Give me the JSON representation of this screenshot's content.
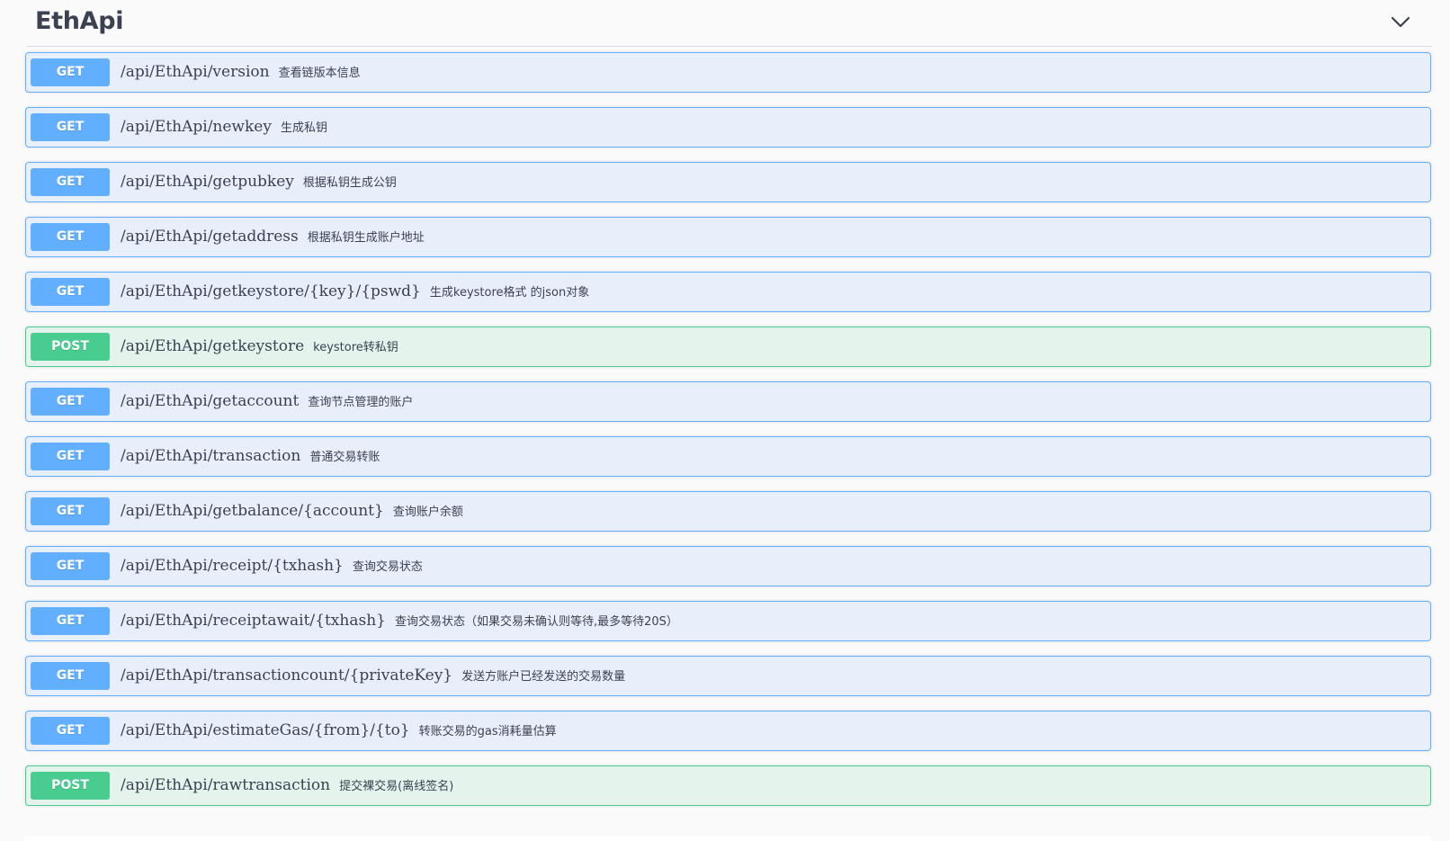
{
  "section": {
    "title": "EthApi",
    "toggle_icon": "chevron-down-icon"
  },
  "colors": {
    "get": "#61affe",
    "post": "#49cc90",
    "text": "#3b4151"
  },
  "operations": [
    {
      "method": "GET",
      "path": "/api/EthApi/version",
      "summary": "查看链版本信息"
    },
    {
      "method": "GET",
      "path": "/api/EthApi/newkey",
      "summary": "生成私钥"
    },
    {
      "method": "GET",
      "path": "/api/EthApi/getpubkey",
      "summary": "根据私钥生成公钥"
    },
    {
      "method": "GET",
      "path": "/api/EthApi/getaddress",
      "summary": "根据私钥生成账户地址"
    },
    {
      "method": "GET",
      "path": "/api/EthApi/getkeystore/{key}/{pswd}",
      "summary": "生成keystore格式 的json对象"
    },
    {
      "method": "POST",
      "path": "/api/EthApi/getkeystore",
      "summary": "keystore转私钥"
    },
    {
      "method": "GET",
      "path": "/api/EthApi/getaccount",
      "summary": "查询节点管理的账户"
    },
    {
      "method": "GET",
      "path": "/api/EthApi/transaction",
      "summary": "普通交易转账"
    },
    {
      "method": "GET",
      "path": "/api/EthApi/getbalance/{account}",
      "summary": "查询账户余额"
    },
    {
      "method": "GET",
      "path": "/api/EthApi/receipt/{txhash}",
      "summary": "查询交易状态"
    },
    {
      "method": "GET",
      "path": "/api/EthApi/receiptawait/{txhash}",
      "summary": "查询交易状态（如果交易未确认则等待,最多等待20S）"
    },
    {
      "method": "GET",
      "path": "/api/EthApi/transactioncount/{privateKey}",
      "summary": "发送方账户已经发送的交易数量"
    },
    {
      "method": "GET",
      "path": "/api/EthApi/estimateGas/{from}/{to}",
      "summary": "转账交易的gas消耗量估算"
    },
    {
      "method": "POST",
      "path": "/api/EthApi/rawtransaction",
      "summary": "提交裸交易(离线签名)"
    }
  ]
}
